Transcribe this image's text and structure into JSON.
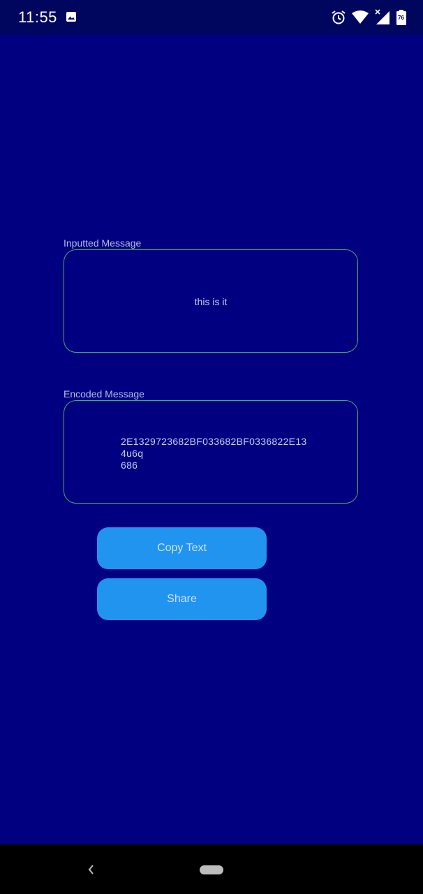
{
  "status_bar": {
    "time": "11:55",
    "battery_level": "76",
    "icons": [
      "photo-icon",
      "alarm-icon",
      "wifi-icon",
      "signal-icon",
      "battery-icon"
    ]
  },
  "input_field": {
    "label": "Inputted Message",
    "value": "this is it"
  },
  "encoded_field": {
    "label": "Encoded Message",
    "value": "2E1329723682BF033682BF0336822E13\n4u6q\n686"
  },
  "buttons": {
    "copy_label": "Copy Text",
    "share_label": "Share"
  },
  "nav_bar": {
    "icons": [
      "back-icon",
      "home-pill-icon"
    ]
  },
  "colors": {
    "background": "#000080",
    "status_bar": "#00065e",
    "field_border": "#3fae6b",
    "button": "#2194f0",
    "nav_bar": "#000000"
  }
}
